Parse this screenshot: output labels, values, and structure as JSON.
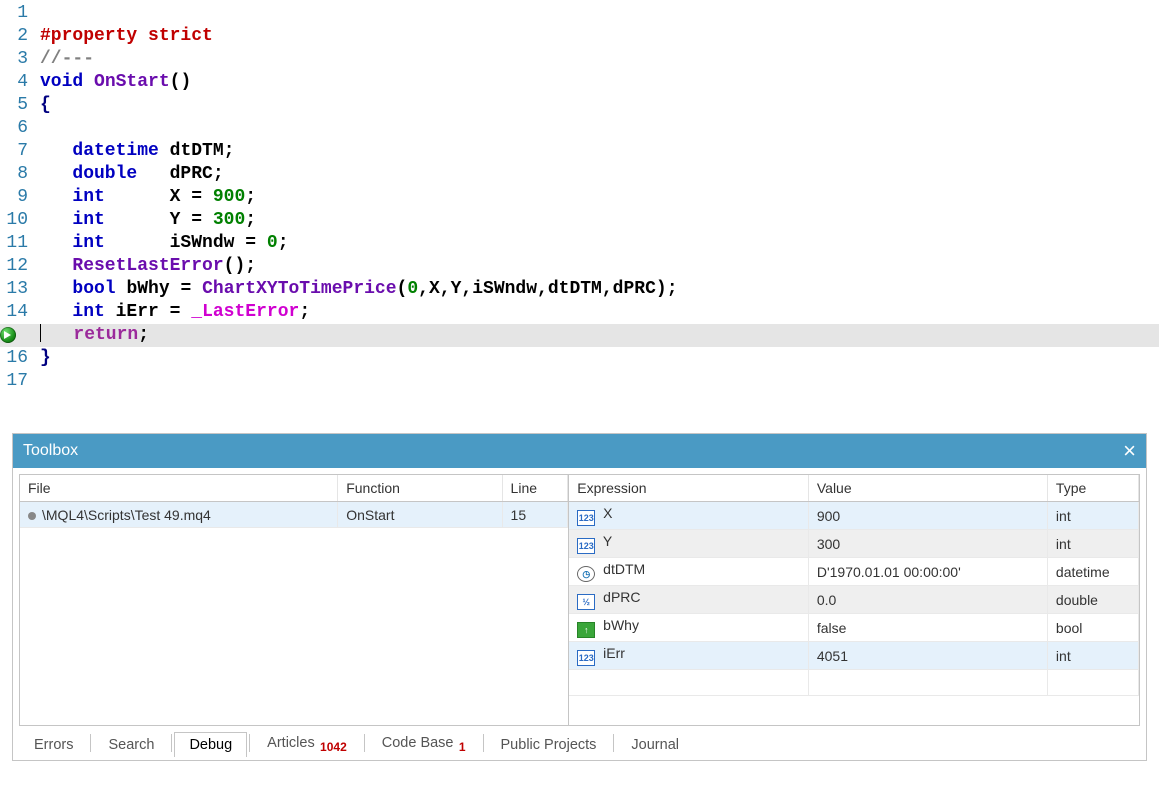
{
  "code": {
    "lines": [
      {
        "n": 1,
        "html": ""
      },
      {
        "n": 2,
        "html": "<span class='c-pre'>#property</span> <span class='c-pre' style='color:#c00000'>strict</span>"
      },
      {
        "n": 3,
        "html": "<span class='c-cmt'>//---</span>"
      },
      {
        "n": 4,
        "html": "<span class='c-kw'>void</span> <span class='c-fn'>OnStart</span><span class='c-pn'>()</span>"
      },
      {
        "n": 5,
        "html": "<span class='c-br'>{</span>"
      },
      {
        "n": 6,
        "html": ""
      },
      {
        "n": 7,
        "html": "   <span class='c-kw'>datetime</span> <span class='c-id'>dtDTM</span><span class='c-pn'>;</span>"
      },
      {
        "n": 8,
        "html": "   <span class='c-kw'>double</span>   <span class='c-id'>dPRC</span><span class='c-pn'>;</span>"
      },
      {
        "n": 9,
        "html": "   <span class='c-kw'>int</span>      <span class='c-id'>X</span> <span class='c-pn'>=</span> <span class='c-num'>900</span><span class='c-pn'>;</span>"
      },
      {
        "n": 10,
        "html": "   <span class='c-kw'>int</span>      <span class='c-id'>Y</span> <span class='c-pn'>=</span> <span class='c-num'>300</span><span class='c-pn'>;</span>"
      },
      {
        "n": 11,
        "html": "   <span class='c-kw'>int</span>      <span class='c-id'>iSWndw</span> <span class='c-pn'>=</span> <span class='c-num'>0</span><span class='c-pn'>;</span>"
      },
      {
        "n": 12,
        "html": "   <span class='c-fn'>ResetLastError</span><span class='c-pn'>();</span>"
      },
      {
        "n": 13,
        "html": "   <span class='c-kw'>bool</span> <span class='c-id'>bWhy</span> <span class='c-pn'>=</span> <span class='c-fn'>ChartXYToTimePrice</span><span class='c-pn'>(</span><span class='c-num'>0</span><span class='c-pn'>,</span><span class='c-id'>X</span><span class='c-pn'>,</span><span class='c-id'>Y</span><span class='c-pn'>,</span><span class='c-id'>iSWndw</span><span class='c-pn'>,</span><span class='c-id'>dtDTM</span><span class='c-pn'>,</span><span class='c-id'>dPRC</span><span class='c-pn'>);</span>"
      },
      {
        "n": 14,
        "html": "   <span class='c-kw'>int</span> <span class='c-id'>iErr</span> <span class='c-pn'>=</span> <span class='c-err'>_LastError</span><span class='c-pn'>;</span>"
      },
      {
        "n": 15,
        "html": "   <span class='c-ret'>return</span><span class='c-pn'>;</span>",
        "bp": true,
        "hl": true,
        "cursor": true
      },
      {
        "n": 16,
        "html": "<span class='c-br'>}</span>"
      },
      {
        "n": 17,
        "html": ""
      }
    ]
  },
  "toolbox": {
    "title": "Toolbox",
    "stack": {
      "headers": [
        "File",
        "Function",
        "Line"
      ],
      "rows": [
        {
          "file": "\\MQL4\\Scripts\\Test 49.mq4",
          "fn": "OnStart",
          "line": "15",
          "sel": true
        }
      ]
    },
    "watch": {
      "headers": [
        "Expression",
        "Value",
        "Type"
      ],
      "rows": [
        {
          "name": "X",
          "value": "900",
          "type": "int",
          "ic": "ic-int",
          "gly": "123",
          "sel": true
        },
        {
          "name": "Y",
          "value": "300",
          "type": "int",
          "ic": "ic-int",
          "gly": "123",
          "alt": true
        },
        {
          "name": "dtDTM",
          "value": "D'1970.01.01 00:00:00'",
          "type": "datetime",
          "ic": "ic-dt",
          "gly": "◷"
        },
        {
          "name": "dPRC",
          "value": "0.0",
          "type": "double",
          "ic": "ic-dbl",
          "gly": "½",
          "alt": true
        },
        {
          "name": "bWhy",
          "value": "false",
          "type": "bool",
          "ic": "ic-bool",
          "gly": "↑"
        },
        {
          "name": "iErr",
          "value": "4051",
          "type": "int",
          "ic": "ic-int",
          "gly": "123",
          "sel": true
        },
        {
          "name": "",
          "value": "",
          "type": "",
          "ic": "",
          "gly": ""
        }
      ]
    },
    "tabs": [
      {
        "label": "Errors"
      },
      {
        "label": "Search"
      },
      {
        "label": "Debug",
        "active": true
      },
      {
        "label": "Articles",
        "badge": "1042"
      },
      {
        "label": "Code Base",
        "badge": "1"
      },
      {
        "label": "Public Projects"
      },
      {
        "label": "Journal"
      }
    ]
  }
}
